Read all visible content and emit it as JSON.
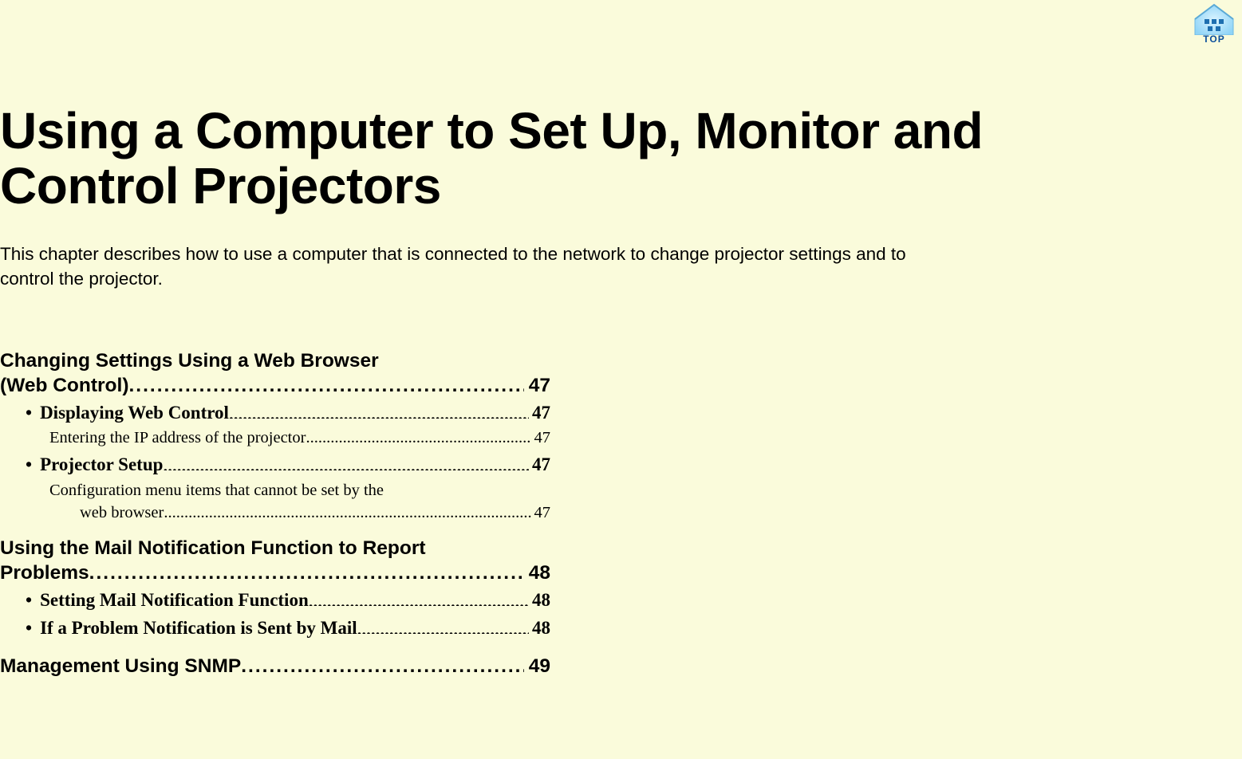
{
  "top_badge": {
    "label": "TOP"
  },
  "title": "Using a Computer to Set Up, Monitor and Control Projectors",
  "intro": "This chapter describes how to use a computer that is connected to the network to change projector settings and to control the projector.",
  "toc": {
    "sec1": {
      "title": "Changing Settings Using a Web Browser (Web Control)",
      "page": "47"
    },
    "sec1_sub1": {
      "title": "Displaying Web Control",
      "page": "47"
    },
    "sec1_sub1_m1": {
      "title": "Entering the IP address of the projector",
      "page": "47"
    },
    "sec1_sub2": {
      "title": "Projector Setup",
      "page": "47"
    },
    "sec1_sub2_m1a": "Configuration menu items that cannot be set by the",
    "sec1_sub2_m1b": {
      "title": "web browser",
      "page": "47"
    },
    "sec2": {
      "title": "Using the Mail Notification Function to Report Problems",
      "page": "48"
    },
    "sec2_sub1": {
      "title": "Setting Mail Notification Function",
      "page": "48"
    },
    "sec2_sub2": {
      "title": "If a Problem Notification is Sent by Mail",
      "page": "48"
    },
    "sec3": {
      "title": "Management Using SNMP",
      "page": "49"
    }
  }
}
